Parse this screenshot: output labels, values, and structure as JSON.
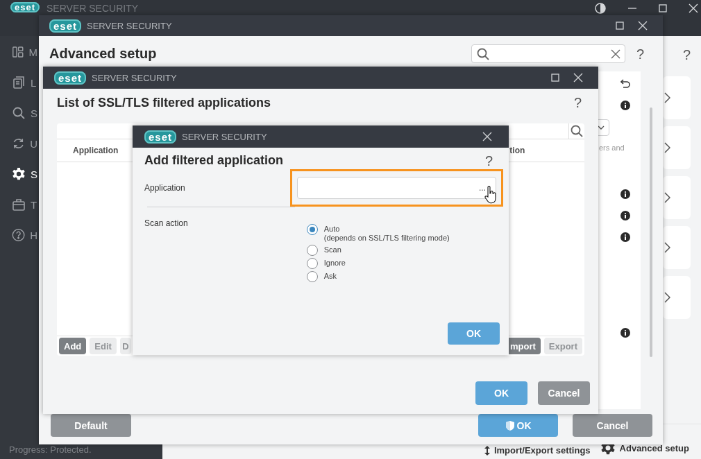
{
  "app": {
    "logo": "eset",
    "product": "SERVER SECURITY",
    "help": "?",
    "sidebar": [
      {
        "label": "M",
        "selected": false
      },
      {
        "label": "L",
        "selected": false
      },
      {
        "label": "S",
        "selected": false
      },
      {
        "label": "U",
        "selected": false
      },
      {
        "label": "S",
        "selected": true
      },
      {
        "label": "T",
        "selected": false
      },
      {
        "label": "H",
        "selected": false
      }
    ],
    "status": "Progress: Protected.",
    "footer_links": [
      "Import/Export settings",
      "Advanced setup"
    ]
  },
  "advanced_setup": {
    "logo": "eset",
    "product": "SERVER SECURITY",
    "title": "Advanced setup",
    "help": "?",
    "panel": [
      {
        "kind": "undo"
      },
      {
        "kind": "info"
      },
      {
        "kind": "dropdown"
      },
      {
        "kind": "text",
        "text": "ers and"
      },
      {
        "kind": "info"
      },
      {
        "kind": "info"
      },
      {
        "kind": "info"
      },
      {
        "kind": "info"
      }
    ],
    "buttons": [
      {
        "label": "Default",
        "kind": "secondary"
      },
      {
        "label": "OK",
        "kind": "apply"
      },
      {
        "label": "Cancel",
        "kind": "secondary"
      }
    ]
  },
  "list_window": {
    "logo": "eset",
    "product": "SERVER SECURITY",
    "title": "List of SSL/TLS filtered applications",
    "help": "?",
    "columns": [
      "Application",
      "tion"
    ],
    "toolbar": [
      {
        "label": "Add",
        "disabled": false
      },
      {
        "label": "Edit",
        "disabled": true
      },
      {
        "label": "D",
        "disabled": true
      },
      {
        "label": "mport",
        "disabled": false
      },
      {
        "label": "Export",
        "disabled": true
      }
    ],
    "buttons": [
      {
        "label": "OK",
        "kind": "primary"
      },
      {
        "label": "Cancel",
        "kind": "secondary"
      }
    ]
  },
  "dialog": {
    "logo": "eset",
    "product": "SERVER SECURITY",
    "title": "Add filtered application",
    "help": "?",
    "application_label": "Application",
    "browse": "...",
    "scan_action_label": "Scan action",
    "options": [
      {
        "label": "Auto",
        "note": "(depends on SSL/TLS filtering mode)",
        "selected": true
      },
      {
        "label": "Scan",
        "selected": false
      },
      {
        "label": "Ignore",
        "selected": false
      },
      {
        "label": "Ask",
        "selected": false
      }
    ],
    "ok": "OK"
  }
}
